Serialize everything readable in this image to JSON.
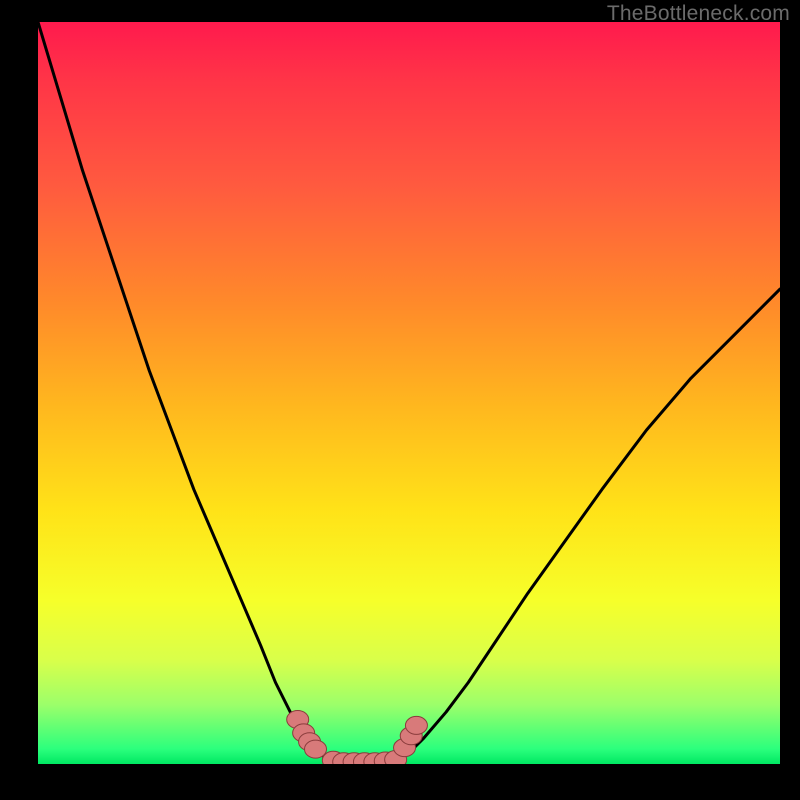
{
  "watermark": "TheBottleneck.com",
  "colors": {
    "frame": "#000000",
    "gradient_top": "#ff1a4d",
    "gradient_bottom": "#00e862",
    "curve": "#000000",
    "marker_fill": "#d87a7a",
    "marker_stroke": "#8a3c3c"
  },
  "chart_data": {
    "type": "line",
    "title": "",
    "xlabel": "",
    "ylabel": "",
    "xlim": [
      0,
      100
    ],
    "ylim": [
      0,
      100
    ],
    "grid": false,
    "legend": false,
    "series": [
      {
        "name": "left-curve",
        "x": [
          0,
          3,
          6,
          9,
          12,
          15,
          18,
          21,
          24,
          27,
          30,
          32,
          34,
          35.5,
          37,
          38.5,
          39.8
        ],
        "y": [
          100,
          90,
          80,
          71,
          62,
          53,
          45,
          37,
          30,
          23,
          16,
          11,
          7,
          4.5,
          2.5,
          1,
          0.2
        ]
      },
      {
        "name": "valley-floor",
        "x": [
          39.8,
          41,
          42.5,
          44,
          45.5,
          47,
          48.2
        ],
        "y": [
          0.2,
          0.0,
          0.0,
          0.0,
          0.0,
          0.0,
          0.2
        ]
      },
      {
        "name": "right-curve",
        "x": [
          48.2,
          50,
          52,
          55,
          58,
          62,
          66,
          71,
          76,
          82,
          88,
          94,
          100
        ],
        "y": [
          0.2,
          1.5,
          3.5,
          7,
          11,
          17,
          23,
          30,
          37,
          45,
          52,
          58,
          64
        ]
      }
    ],
    "markers": [
      {
        "cluster": "left-neck",
        "points": [
          {
            "x": 35.0,
            "y": 6.0
          },
          {
            "x": 35.8,
            "y": 4.2
          },
          {
            "x": 36.6,
            "y": 3.0
          },
          {
            "x": 37.4,
            "y": 2.0
          }
        ]
      },
      {
        "cluster": "floor",
        "points": [
          {
            "x": 39.8,
            "y": 0.5
          },
          {
            "x": 41.2,
            "y": 0.3
          },
          {
            "x": 42.6,
            "y": 0.3
          },
          {
            "x": 44.0,
            "y": 0.3
          },
          {
            "x": 45.4,
            "y": 0.3
          },
          {
            "x": 46.8,
            "y": 0.4
          },
          {
            "x": 48.2,
            "y": 0.6
          }
        ]
      },
      {
        "cluster": "right-neck",
        "points": [
          {
            "x": 49.4,
            "y": 2.2
          },
          {
            "x": 50.3,
            "y": 3.8
          },
          {
            "x": 51.0,
            "y": 5.2
          }
        ]
      }
    ]
  }
}
